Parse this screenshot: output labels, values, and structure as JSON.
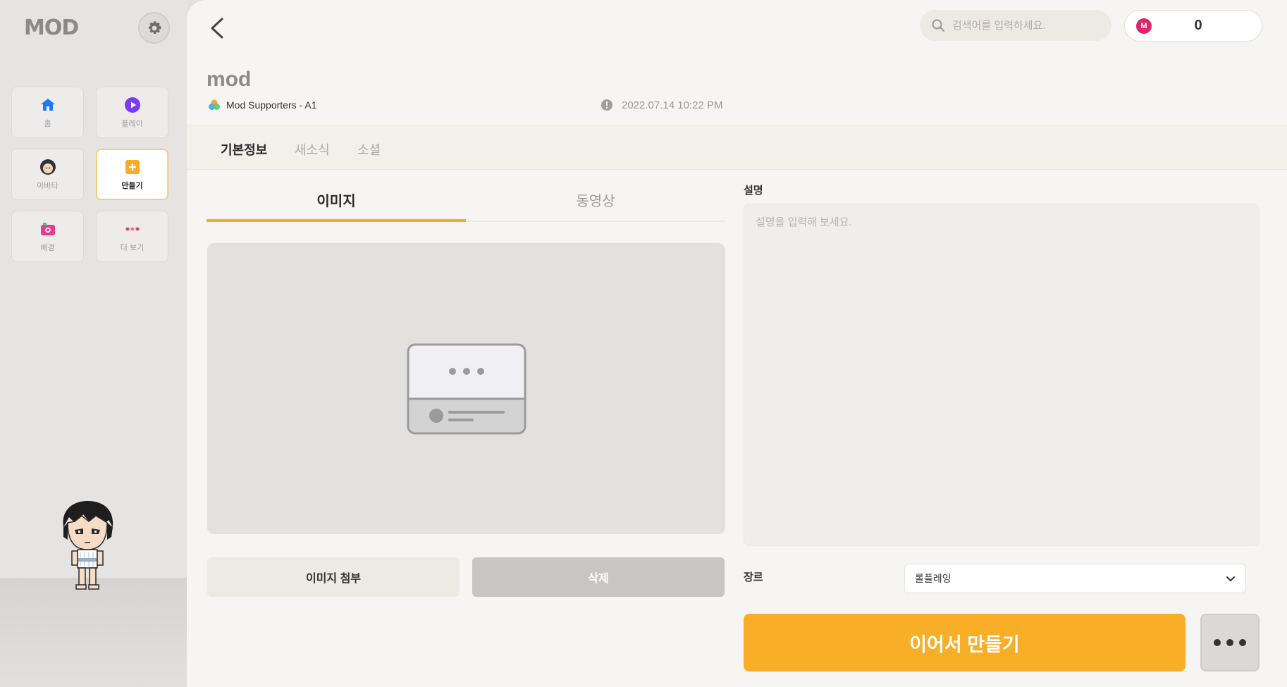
{
  "sidebar": {
    "logo": "MOD",
    "settings_icon": "gear-icon",
    "items": [
      {
        "label": "홈",
        "icon": "home-icon",
        "color": "#1a7cf0"
      },
      {
        "label": "플레이",
        "icon": "play-icon",
        "color": "#7a3cf0"
      },
      {
        "label": "아바타",
        "icon": "avatar-face-icon",
        "color": "#333333"
      },
      {
        "label": "만들기",
        "icon": "create-plus-icon",
        "color": "#f6ac28",
        "active": true
      },
      {
        "label": "배경",
        "icon": "camera-icon",
        "color": "#e83c8a"
      },
      {
        "label": "더 보기",
        "icon": "more-dots-icon",
        "color": "#e0436a"
      }
    ]
  },
  "header": {
    "search_placeholder": "검색어를 입력하세요.",
    "coins": "0",
    "coin_icon_label": "M"
  },
  "project": {
    "title": "mod",
    "owner": "Mod Supporters - A1",
    "date": "2022.07.14 10:22 PM"
  },
  "tabs": [
    "기본정보",
    "새소식",
    "소셜"
  ],
  "media_tabs": [
    "이미지",
    "동영상"
  ],
  "buttons": {
    "attach": "이미지 첨부",
    "delete": "삭제",
    "continue": "이어서 만들기"
  },
  "description": {
    "label": "설명",
    "placeholder": "설명을 입력해 보세요."
  },
  "genre": {
    "label": "장르",
    "value": "롤플레잉"
  },
  "colors": {
    "accent": "#f8ae26",
    "coin": "#e0236a"
  }
}
